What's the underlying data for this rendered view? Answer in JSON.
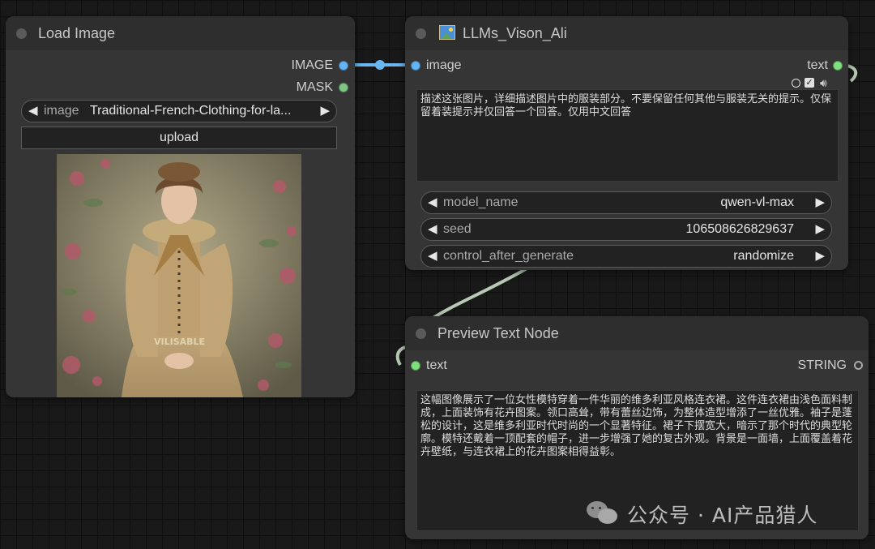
{
  "load_image_node": {
    "title": "Load Image",
    "outputs": {
      "image": "IMAGE",
      "mask": "MASK"
    },
    "image_widget": {
      "name": "image",
      "value": "Traditional-French-Clothing-for-la..."
    },
    "upload_label": "upload",
    "preview_watermark": "VILISABLE"
  },
  "llm_node": {
    "title": "LLMs_Vison_Ali",
    "title_icon": "picture-emoji-icon",
    "input_label": "image",
    "output_label": "text",
    "prompt_text": "描述这张图片，详细描述图片中的服装部分。不要保留任何其他与服装无关的提示。仅保留着装提示并仅回答一个回答。仅用中文回答",
    "widgets": [
      {
        "name": "model_name",
        "value": "qwen-vl-max"
      },
      {
        "name": "seed",
        "value": "106508626829637"
      },
      {
        "name": "control_after_generate",
        "value": "randomize"
      }
    ]
  },
  "preview_node": {
    "title": "Preview Text Node",
    "input_label": "text",
    "output_label": "STRING",
    "text": "这幅图像展示了一位女性模特穿着一件华丽的维多利亚风格连衣裙。这件连衣裙由浅色面料制成，上面装饰有花卉图案。领口高耸，带有蕾丝边饰，为整体造型增添了一丝优雅。袖子是蓬松的设计，这是维多利亚时代时尚的一个显著特征。裙子下摆宽大，暗示了那个时代的典型轮廓。模特还戴着一顶配套的帽子，进一步增强了她的复古外观。背景是一面墙，上面覆盖着花卉壁纸，与连衣裙上的花卉图案相得益彰。"
  },
  "watermark": {
    "icon": "wechat-icon",
    "text": "公众号 · AI产品猎人"
  },
  "colors": {
    "image_slot": "#64b5f6",
    "mask_slot": "#81c784",
    "text_slot": "#7ee07e",
    "string_slot": "#aaaaaa",
    "link_image": "#6ab8f2",
    "link_text": "#b7cab4"
  }
}
